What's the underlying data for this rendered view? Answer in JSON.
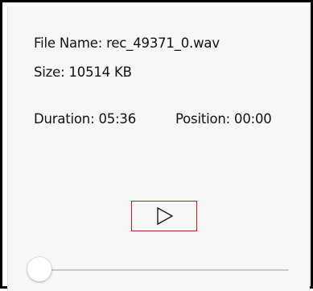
{
  "file": {
    "name_text": "File Name: rec_49371_0.wav",
    "size_text": "Size: 10514 KB"
  },
  "timing": {
    "duration_text": "Duration: 05:36",
    "position_text": "Position: 00:00"
  },
  "controls": {
    "play_icon": "play-icon",
    "accent_border": "#b22222",
    "seek_progress": 0
  }
}
